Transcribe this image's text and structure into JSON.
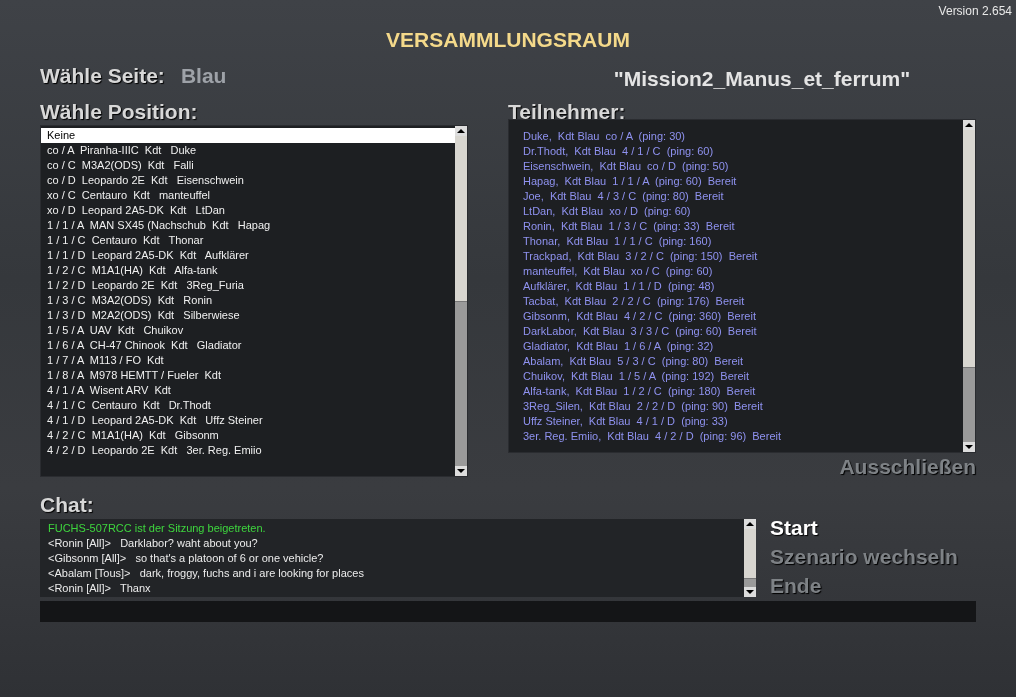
{
  "version": "Version 2.654",
  "title": "VERSAMMLUNGSRAUM",
  "side": {
    "label": "Wähle Seite:",
    "value": "Blau"
  },
  "mission": "\"Mission2_Manus_et_ferrum\"",
  "positions": {
    "label": "Wähle Position:",
    "items": [
      {
        "text": "Keine",
        "selected": true
      },
      {
        "text": "co / A  Piranha-IIIC  Kdt   Duke",
        "selected": false
      },
      {
        "text": "co / C  M3A2(ODS)  Kdt   Falli",
        "selected": false
      },
      {
        "text": "co / D  Leopardo 2E  Kdt   Eisenschwein",
        "selected": false
      },
      {
        "text": "xo / C  Centauro  Kdt   manteuffel",
        "selected": false
      },
      {
        "text": "xo / D  Leopard 2A5-DK  Kdt   LtDan",
        "selected": false
      },
      {
        "text": "1 / 1 / A  MAN SX45 (Nachschub  Kdt   Hapag",
        "selected": false
      },
      {
        "text": "1 / 1 / C  Centauro  Kdt   Thonar",
        "selected": false
      },
      {
        "text": "1 / 1 / D  Leopard 2A5-DK  Kdt   Aufklärer",
        "selected": false
      },
      {
        "text": "1 / 2 / C  M1A1(HA)  Kdt   Alfa-tank",
        "selected": false
      },
      {
        "text": "1 / 2 / D  Leopardo 2E  Kdt   3Reg_Furia",
        "selected": false
      },
      {
        "text": "1 / 3 / C  M3A2(ODS)  Kdt   Ronin",
        "selected": false
      },
      {
        "text": "1 / 3 / D  M2A2(ODS)  Kdt   Silberwiese",
        "selected": false
      },
      {
        "text": "1 / 5 / A  UAV  Kdt   Chuikov",
        "selected": false
      },
      {
        "text": "1 / 6 / A  CH-47 Chinook  Kdt   Gladiator",
        "selected": false
      },
      {
        "text": "1 / 7 / A  M113 / FO  Kdt",
        "selected": false
      },
      {
        "text": "1 / 8 / A  M978 HEMTT / Fueler  Kdt",
        "selected": false
      },
      {
        "text": "4 / 1 / A  Wisent ARV  Kdt",
        "selected": false
      },
      {
        "text": "4 / 1 / C  Centauro  Kdt   Dr.Thodt",
        "selected": false
      },
      {
        "text": "4 / 1 / D  Leopard 2A5-DK  Kdt   Uffz Steiner",
        "selected": false
      },
      {
        "text": "4 / 2 / C  M1A1(HA)  Kdt   Gibsonm",
        "selected": false
      },
      {
        "text": "4 / 2 / D  Leopardo 2E  Kdt   3er. Reg. Emiio",
        "selected": false
      }
    ]
  },
  "participants": {
    "label": "Teilnehmer:",
    "items": [
      "Duke,  Kdt Blau  co / A  (ping: 30)",
      "Dr.Thodt,  Kdt Blau  4 / 1 / C  (ping: 60)",
      "Eisenschwein,  Kdt Blau  co / D  (ping: 50)",
      "Hapag,  Kdt Blau  1 / 1 / A  (ping: 60)  Bereit",
      "Joe,  Kdt Blau  4 / 3 / C  (ping: 80)  Bereit",
      "LtDan,  Kdt Blau  xo / D  (ping: 60)",
      "Ronin,  Kdt Blau  1 / 3 / C  (ping: 33)  Bereit",
      "Thonar,  Kdt Blau  1 / 1 / C  (ping: 160)",
      "Trackpad,  Kdt Blau  3 / 2 / C  (ping: 150)  Bereit",
      "manteuffel,  Kdt Blau  xo / C  (ping: 60)",
      "Aufklärer,  Kdt Blau  1 / 1 / D  (ping: 48)",
      "Tacbat,  Kdt Blau  2 / 2 / C  (ping: 176)  Bereit",
      "Gibsonm,  Kdt Blau  4 / 2 / C  (ping: 360)  Bereit",
      "DarkLabor,  Kdt Blau  3 / 3 / C  (ping: 60)  Bereit",
      "Gladiator,  Kdt Blau  1 / 6 / A  (ping: 32)",
      "Abalam,  Kdt Blau  5 / 3 / C  (ping: 80)  Bereit",
      "Chuikov,  Kdt Blau  1 / 5 / A  (ping: 192)  Bereit",
      "Alfa-tank,  Kdt Blau  1 / 2 / C  (ping: 180)  Bereit",
      "3Reg_Silen,  Kdt Blau  2 / 2 / D  (ping: 90)  Bereit",
      "Uffz Steiner,  Kdt Blau  4 / 1 / D  (ping: 33)",
      "3er. Reg. Emiio,  Kdt Blau  4 / 2 / D  (ping: 96)  Bereit"
    ],
    "kick": {
      "label": "Ausschließen",
      "disabled": true
    }
  },
  "chat": {
    "label": "Chat:",
    "messages": [
      {
        "kind": "system",
        "text": "FUCHS-507RCC ist der Sitzung beigetreten."
      },
      {
        "kind": "message",
        "text": "<Ronin [All]>   Darklabor? waht about you?"
      },
      {
        "kind": "message",
        "text": "<Gibsonm [All]>   so that's a platoon of 6 or one vehicle?"
      },
      {
        "kind": "message",
        "text": "<Abalam [Tous]>   dark, froggy, fuchs and i are looking for places"
      },
      {
        "kind": "message",
        "text": "<Ronin [All]>   Thanx"
      }
    ]
  },
  "menu": [
    {
      "label": "Start",
      "disabled": false
    },
    {
      "label": "Szenario wechseln",
      "disabled": true
    },
    {
      "label": "Ende",
      "disabled": true
    }
  ]
}
